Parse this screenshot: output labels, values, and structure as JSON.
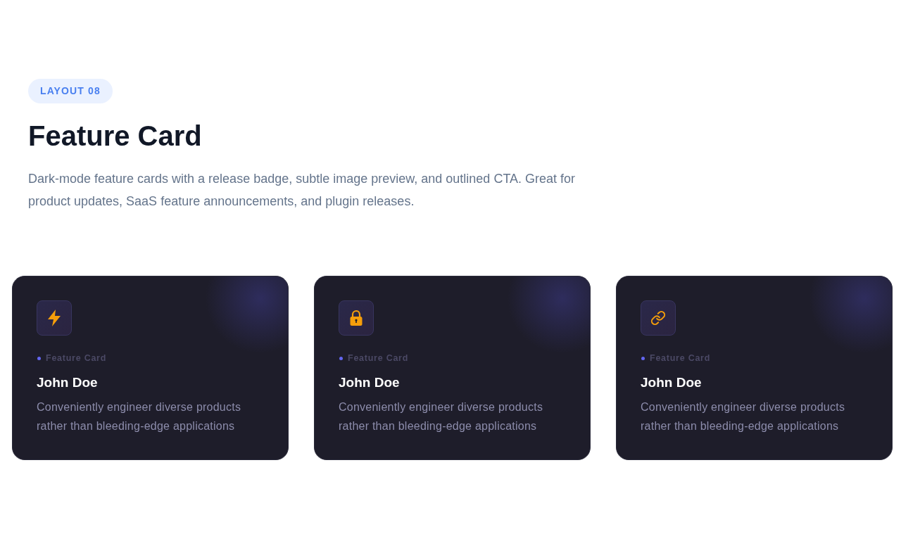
{
  "header": {
    "badge": "LAYOUT 08",
    "title": "Feature Card",
    "description": "Dark-mode feature cards with a release badge, subtle image preview, and outlined CTA. Great for product updates, SaaS feature announcements, and plugin releases."
  },
  "cards": [
    {
      "tag": "Feature Card",
      "title": "John Doe",
      "description": "Conveniently engineer diverse products rather than bleeding-edge applications"
    },
    {
      "tag": "Feature Card",
      "title": "John Doe",
      "description": "Conveniently engineer diverse products rather than bleeding-edge applications"
    },
    {
      "tag": "Feature Card",
      "title": "John Doe",
      "description": "Conveniently engineer diverse products rather than bleeding-edge applications"
    }
  ]
}
